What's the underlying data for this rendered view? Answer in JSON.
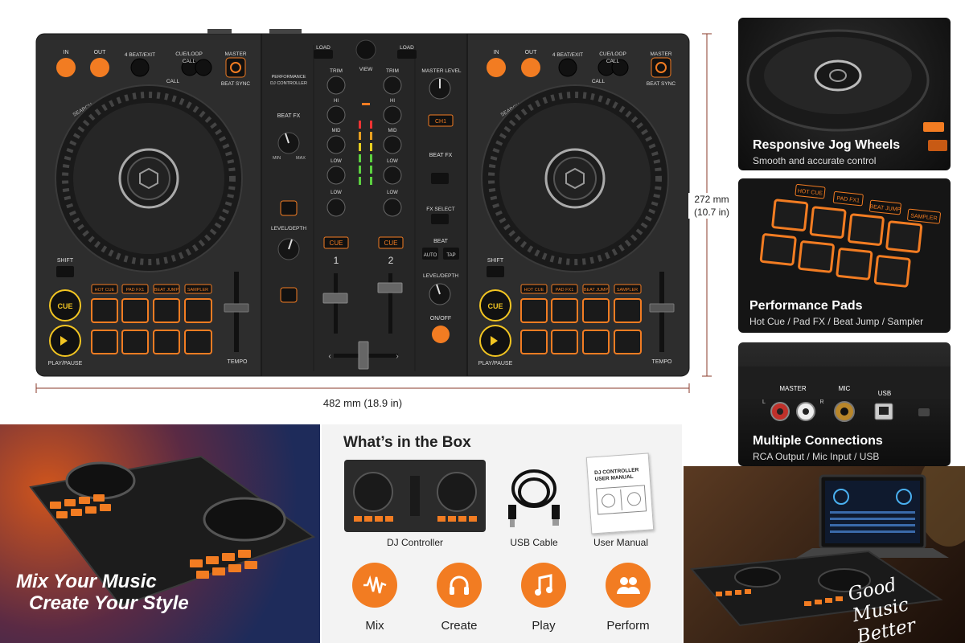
{
  "controller": {
    "deckA": {
      "in": "IN",
      "out": "OUT",
      "beat_exit": "4 BEAT/EXIT",
      "cue_loop": "CUE/LOOP",
      "call": "CALL",
      "call2": "CALL",
      "master": "MASTER",
      "beat_sync": "BEAT SYNC",
      "search": "SEARCH",
      "shift": "SHIFT",
      "cue": "CUE",
      "play_pause": "PLAY/PAUSE",
      "tempo": "TEMPO",
      "pad_modes": [
        "HOT CUE",
        "PAD FX1",
        "BEAT JUMP",
        "SAMPLER"
      ]
    },
    "deckB": {
      "in": "IN",
      "out": "OUT",
      "beat_exit": "4 BEAT/EXIT",
      "cue_loop": "CUE/LOOP",
      "call": "CALL",
      "call2": "CALL",
      "master": "MASTER",
      "beat_sync": "BEAT SYNC",
      "search": "SEARCH",
      "shift": "SHIFT",
      "cue": "CUE",
      "play_pause": "PLAY/PAUSE",
      "tempo": "TEMPO",
      "pad_modes": [
        "HOT CUE",
        "PAD FX1",
        "BEAT JUMP",
        "SAMPLER"
      ]
    },
    "mixer": {
      "performance": "PERFORMANCE",
      "dj_controller": "DJ CONTROLLER",
      "beat_fx": "BEAT FX",
      "min": "MIN",
      "max": "MAX",
      "level_depth": "LEVEL/DEPTH",
      "load": "LOAD",
      "view": "VIEW",
      "trim": "TRIM",
      "hi": "HI",
      "mid": "MID",
      "low": "LOW",
      "cue": "CUE",
      "ch1": "1",
      "ch2": "2",
      "master_level": "MASTER LEVEL",
      "ch_badge": "CH1",
      "fx_beat": "BEAT FX",
      "fx_select": "FX SELECT",
      "beat": "BEAT",
      "auto": "AUTO",
      "tap": "TAP",
      "level_depth2": "LEVEL/DEPTH",
      "on_off": "ON/OFF"
    }
  },
  "dimensions": {
    "width": "482 mm (18.9 in)",
    "depth": "272 mm",
    "depth_in": "(10.7 in)"
  },
  "features": [
    {
      "title": "Responsive Jog Wheels",
      "subtitle": "Smooth and accurate control"
    },
    {
      "title": "Performance Pads",
      "subtitle": "Hot Cue / Pad FX / Beat Jump / Sampler",
      "pad_labels": [
        "HOT CUE",
        "PAD FX1",
        "BEAT JUMP",
        "SAMPLER"
      ]
    },
    {
      "title": "Multiple Connections",
      "subtitle": "RCA Output / Mic Input / USB",
      "port_labels": [
        "MASTER",
        "MIC",
        "USB",
        "L",
        "R"
      ]
    }
  ],
  "box": {
    "title": "What’s in the Box",
    "items": [
      "DJ Controller",
      "USB Cable",
      "User Manual"
    ],
    "manual_cover": "DJ CONTROLLER USER MANUAL"
  },
  "uses": [
    {
      "label": "Mix",
      "icon": "waveform-icon"
    },
    {
      "label": "Create",
      "icon": "headphones-icon"
    },
    {
      "label": "Play",
      "icon": "music-note-icon"
    },
    {
      "label": "Perform",
      "icon": "people-icon"
    }
  ],
  "slogan": {
    "line1": "Mix Your Music",
    "line2": "Create Your Style"
  },
  "tagline": {
    "line1": "Good Music",
    "line2": "Better Vibes"
  },
  "colors": {
    "accent": "#f27c22",
    "body": "#2b2b2b",
    "pad": "#f27c22"
  }
}
